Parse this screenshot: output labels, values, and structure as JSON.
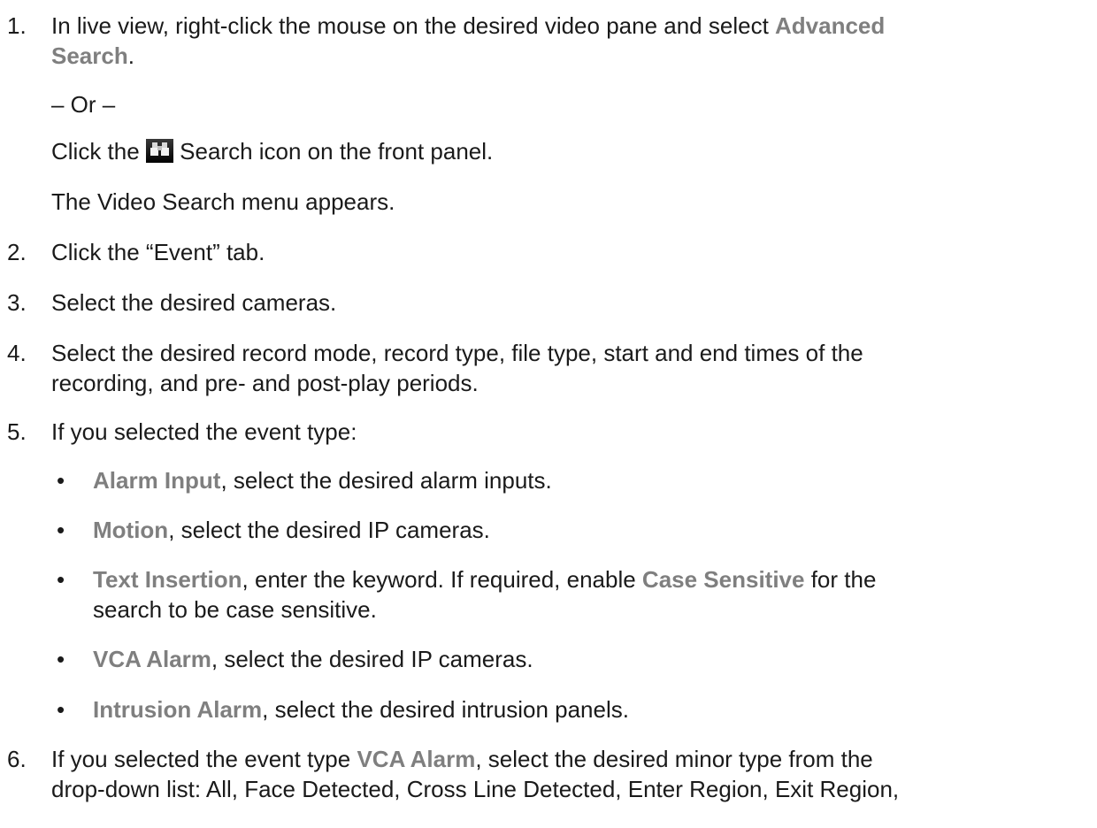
{
  "steps": [
    {
      "number": "1.",
      "line1_prefix": "In live view, right-click the mouse on the desired video pane and select ",
      "line1_hl": "Advanced",
      "line2_hl": "Search",
      "line2_suffix": ".",
      "or_text": "– Or –",
      "click_prefix": "Click the ",
      "click_suffix": " Search icon on the front panel.",
      "result_text": "The Video Search menu appears."
    },
    {
      "number": "2.",
      "text": "Click the “Event” tab."
    },
    {
      "number": "3.",
      "text": "Select the desired cameras."
    },
    {
      "number": "4.",
      "line1": "Select the desired record mode, record type, file type, start and end times of the",
      "line2": "recording, and pre- and post-play periods."
    },
    {
      "number": "5.",
      "text": "If you selected the event type:",
      "bullets": [
        {
          "hl": "Alarm Input",
          "text": ", select the desired alarm inputs."
        },
        {
          "hl": "Motion",
          "text": ", select the desired IP cameras."
        },
        {
          "hl": "Text Insertion",
          "text": ", enter the keyword. If required, enable ",
          "hl2": "Case Sensitive",
          "text2": " for the",
          "line2": "search to be case sensitive."
        },
        {
          "hl": "VCA Alarm",
          "text": ", select the desired IP cameras."
        },
        {
          "hl": "Intrusion Alarm",
          "text": ", select the desired intrusion panels."
        }
      ]
    },
    {
      "number": "6.",
      "prefix": "If you selected the event type ",
      "hl": "VCA Alarm",
      "suffix": ", select the desired minor type from the",
      "line2": "drop-down list: All, Face Detected, Cross Line Detected, Enter Region, Exit Region,"
    }
  ],
  "bullet_char": "•",
  "icons": {
    "search": "binoculars-icon"
  }
}
